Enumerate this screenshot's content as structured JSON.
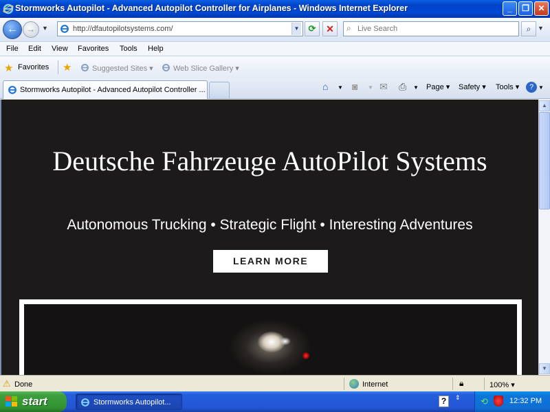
{
  "window": {
    "title": "Stormworks Autopilot - Advanced Autopilot Controller for Airplanes - Windows Internet Explorer",
    "minimize_glyph": "_",
    "maximize_glyph": "❐",
    "close_glyph": "✕"
  },
  "nav": {
    "back_glyph": "←",
    "forward_glyph": "→",
    "address": "http://dfautopilotsystems.com/",
    "search_placeholder": "Live Search"
  },
  "menu": [
    "File",
    "Edit",
    "View",
    "Favorites",
    "Tools",
    "Help"
  ],
  "favorites": {
    "label": "Favorites",
    "items": [
      "Suggested Sites ▾",
      "Web Slice Gallery ▾"
    ]
  },
  "tabs": {
    "active_label": "Stormworks Autopilot - Advanced Autopilot Controller ...",
    "commands": [
      "Page ▾",
      "Safety ▾",
      "Tools ▾"
    ]
  },
  "page": {
    "hero_title": "Deutsche Fahrzeuge AutoPilot Systems",
    "hero_subtitle": "Autonomous Trucking • Strategic Flight • Interesting Adventures",
    "cta_label": "LEARN MORE"
  },
  "status": {
    "text": "Done",
    "zone": "Internet",
    "zoom": "100% ▾"
  },
  "taskbar": {
    "start_label": "start",
    "task_label": "Stormworks Autopilot...",
    "clock": "12:32 PM",
    "help_glyph": "?"
  },
  "colors": {
    "hero_background": "#1c1a1b",
    "titlebar": "#0342c7",
    "start_button": "#3c9e3c"
  }
}
